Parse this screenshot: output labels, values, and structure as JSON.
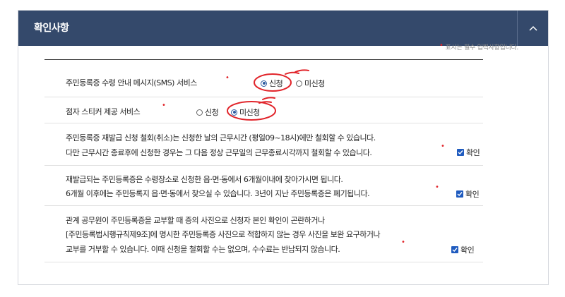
{
  "header": {
    "title": "확인사항",
    "toggle_icon": "chevron-up-icon"
  },
  "required_note": {
    "marker": "•",
    "text": "표시는 필수 입력사항입니다."
  },
  "sms": {
    "label": "주민등록증 수령 안내 메시지(SMS) 서비스",
    "options": [
      {
        "label": "신청",
        "selected": true
      },
      {
        "label": "미신청",
        "selected": false
      }
    ]
  },
  "sticker": {
    "label": "점자 스티커 제공 서비스",
    "options": [
      {
        "label": "신청",
        "selected": false
      },
      {
        "label": "미신청",
        "selected": true
      }
    ]
  },
  "confirms": [
    {
      "lines": [
        "주민등록증 재발급 신청 철회(취소)는 신청한 날의 근무시간 (평일09~18시)에만 철회할 수 있습니다.",
        "다만 근무시간 종료후에 신청한 경우는 그 다음 정상 근무일의 근무종료시각까지 철회할 수 있습니다."
      ],
      "check_label": "확인",
      "checked": true
    },
    {
      "lines": [
        "재발급되는 주민등록증은 수령장소로 신청한 읍·면·동에서 6개월이내에 찾아가시면 됩니다.",
        "6개월 이후에는 주민등록지 읍·면·동에서 찾으실 수 있습니다. 3년이 지난 주민등록증은 폐기됩니다."
      ],
      "check_label": "확인",
      "checked": true
    },
    {
      "lines": [
        "관계 공무원이 주민등록증을 교부할 때 증의 사진으로 신청자 본인 확인이 곤란하거나",
        "[주민등록법시행규칙제9조]에 명시한 주민등록증 사진으로 적합하지 않는 경우 사진을 보완 요구하거나",
        "교부를 거부할 수 있습니다. 이때 신청을 철회할 수는 없으며, 수수료는 반납되지 않습니다."
      ],
      "check_label": "확인",
      "checked": true
    }
  ],
  "colors": {
    "header_bg": "#34496b",
    "required_dot": "#e1242a",
    "checkbox": "#1f5bbf",
    "annotation": "#e1242a"
  }
}
